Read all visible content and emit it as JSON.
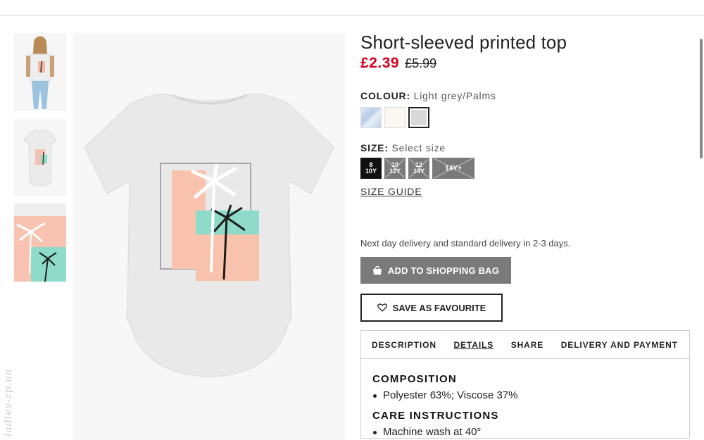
{
  "product": {
    "title": "Short-sleeved printed top",
    "price_sale": "£2.39",
    "price_original": "£5.99"
  },
  "colour": {
    "label": "COLOUR:",
    "value": "Light grey/Palms",
    "swatches": [
      "blue-print",
      "off-white",
      "light-grey"
    ],
    "selected": "light-grey"
  },
  "size": {
    "label": "SIZE:",
    "value": "Select size",
    "options": [
      {
        "line1": "8",
        "line2": "10Y",
        "available": true
      },
      {
        "line1": "10",
        "line2": "12Y",
        "available": false
      },
      {
        "line1": "12",
        "line2": "14Y",
        "available": false
      },
      {
        "line1": "14Y+",
        "line2": "",
        "available": false
      }
    ],
    "guide": "SIZE GUIDE"
  },
  "delivery_text": "Next day delivery and standard delivery in 2-3 days.",
  "buttons": {
    "add_to_bag": "ADD TO SHOPPING BAG",
    "save_favourite": "SAVE AS FAVOURITE"
  },
  "tabs": [
    "DESCRIPTION",
    "DETAILS",
    "SHARE",
    "DELIVERY AND PAYMENT"
  ],
  "active_tab": "DETAILS",
  "details": {
    "composition_heading": "COMPOSITION",
    "composition": "Polyester 63%; Viscose 37%",
    "care_heading": "CARE INSTRUCTIONS",
    "care": "Machine wash at 40°"
  },
  "watermark": "ladies-zp.ua",
  "colors": {
    "sale": "#d6001c",
    "bag_button": "#7a7a7a",
    "size_available": "#111111",
    "size_unavailable": "#7a7a7a"
  }
}
